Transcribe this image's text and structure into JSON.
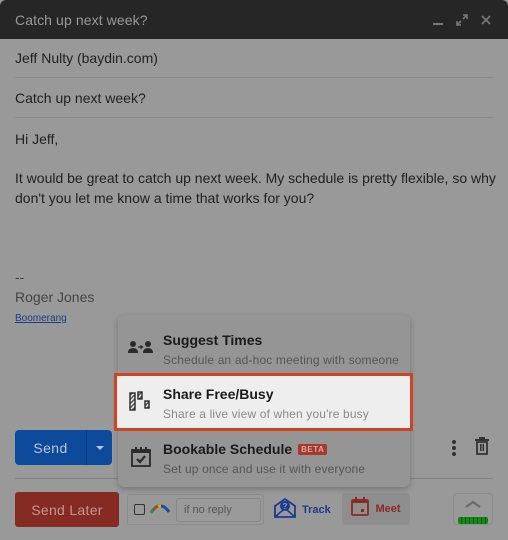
{
  "window": {
    "title": "Catch up next week?",
    "controls": [
      {
        "name": "minimize-icon"
      },
      {
        "name": "expand-icon"
      },
      {
        "name": "close-icon"
      }
    ]
  },
  "compose": {
    "to": "Jeff Nulty (baydin.com)",
    "subject": "Catch up next week?",
    "body": {
      "greeting": "Hi Jeff,",
      "paragraph": "It would be great to catch up next week. My schedule is pretty flexible, so why don't you let me know a time that works for you?",
      "signature_separator": "--",
      "signature_name": "Roger Jones",
      "signature_link": "Boomerang"
    }
  },
  "toolbar": {
    "send_label": "Send",
    "send_later_label": "Send Later",
    "if_no_reply_placeholder": "if no reply",
    "track_label": "Track",
    "meet_label": "Meet"
  },
  "colors": {
    "send": "#0e4a9c",
    "send_later": "#862b22",
    "highlight_border": "#d24325",
    "beta_badge": "#a7392c",
    "battery": "#0f8a12"
  },
  "meet_menu": {
    "items": [
      {
        "title": "Suggest Times",
        "subtitle": "Schedule an ad-hoc meeting with someone",
        "icon": "people-arrow-icon"
      },
      {
        "title": "Share Free/Busy",
        "subtitle": "Share a live view of when you're busy",
        "icon": "free-busy-icon",
        "highlighted": true
      },
      {
        "title": "Bookable Schedule",
        "subtitle": "Set up once and use it with everyone",
        "icon": "calendar-check-icon",
        "badge": "BETA"
      }
    ]
  }
}
